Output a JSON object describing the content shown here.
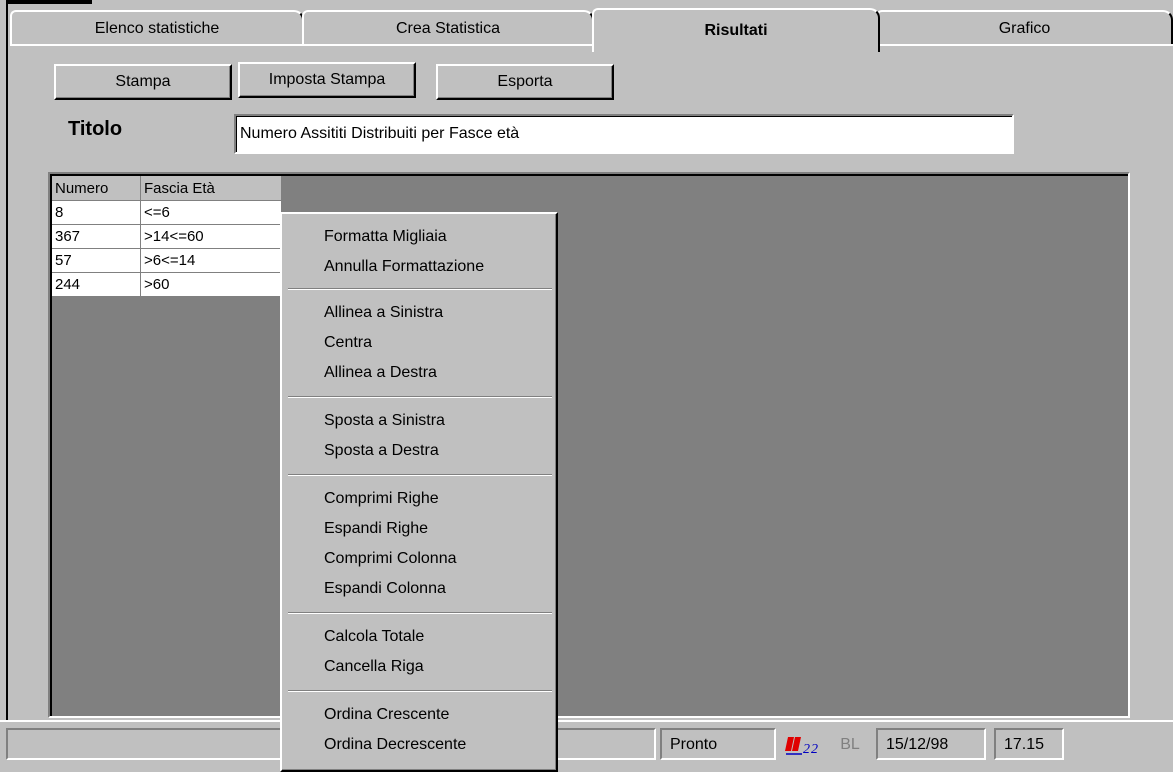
{
  "tabs": [
    {
      "label": "Elenco statistiche"
    },
    {
      "label": "Crea Statistica"
    },
    {
      "label": "Risultati",
      "active": true
    },
    {
      "label": "Grafico"
    }
  ],
  "toolbar": {
    "print_label": "Stampa",
    "print_setup_label": "Imposta Stampa",
    "export_label": "Esporta"
  },
  "title": {
    "label": "Titolo",
    "value": "Numero Assititi Distribuiti per Fasce età"
  },
  "grid": {
    "columns": [
      "Numero",
      "Fascia Età"
    ],
    "rows": [
      [
        "8",
        "<=6"
      ],
      [
        "367",
        ">14<=60"
      ],
      [
        "57",
        ">6<=14"
      ],
      [
        "244",
        ">60"
      ]
    ]
  },
  "context_menu": {
    "items": [
      "Formatta Migliaia",
      "Annulla Formattazione",
      "Allinea a Sinistra",
      "Centra",
      "Allinea a Destra",
      "Sposta a Sinistra",
      "Sposta a Destra",
      "Comprimi Righe",
      "Espandi Righe",
      "Comprimi Colonna",
      "Espandi Colonna",
      "Calcola Totale",
      "Cancella Riga",
      "Ordina Crescente",
      "Ordina Decrescente"
    ]
  },
  "statusbar": {
    "main": "",
    "status": "Pronto",
    "indicator": "BL",
    "date": "15/12/98",
    "time": "17.15"
  },
  "colors": {
    "face": "#c0c0c0",
    "shadow": "#808080",
    "logo_red": "#e00000",
    "logo_blue": "#0000c0"
  }
}
